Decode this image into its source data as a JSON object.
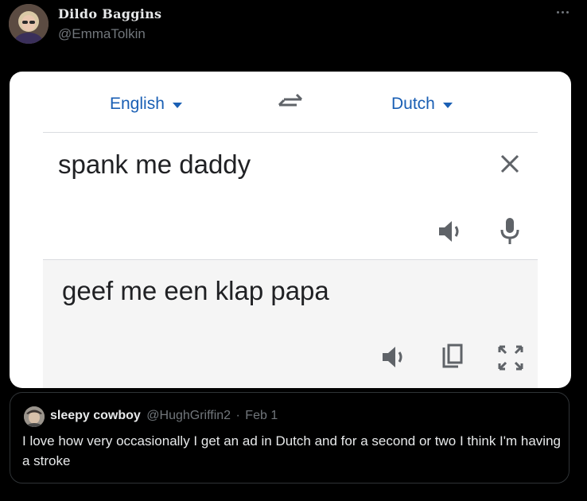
{
  "tweet": {
    "display_name": "Dildo Baggins",
    "handle": "@EmmaTolkin",
    "avatar_icon": "user-avatar",
    "more_icon": "more-horizontal-icon"
  },
  "translate_card": {
    "source_language": "English",
    "target_language": "Dutch",
    "source_text": "spank me daddy",
    "result_text": "geef me een klap papa",
    "accent_color": "#1a5fb4",
    "icons": [
      "swap-languages-icon",
      "clear-icon",
      "speaker-icon",
      "microphone-icon",
      "copy-icon",
      "fullscreen-icon"
    ]
  },
  "quoted_tweet": {
    "display_name": "sleepy cowboy",
    "handle": "@HughGriffin2",
    "separator": "·",
    "date": "Feb 1",
    "text": "I love how very occasionally I get an ad in Dutch and for a second or two I think I'm having a stroke"
  }
}
